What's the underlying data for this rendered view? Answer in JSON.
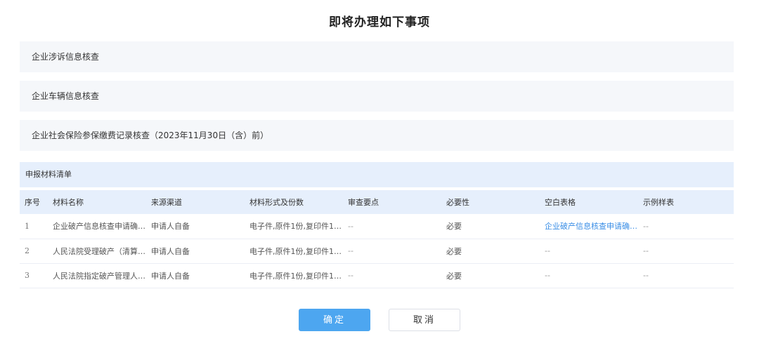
{
  "title": "即将办理如下事项",
  "matters": [
    "企业涉诉信息核查",
    "企业车辆信息核查",
    "企业社会保险参保缴费记录核查（2023年11月30日（含）前）"
  ],
  "materials": {
    "header": "申报材料清单",
    "columns": [
      "序号",
      "材料名称",
      "来源渠道",
      "材料形式及份数",
      "审查要点",
      "必要性",
      "空白表格",
      "示例样表"
    ],
    "rows": [
      {
        "index": "1",
        "name": "企业破产信息核查申请确…",
        "source": "申请人自备",
        "form": "电子件,原件1份,复印件1…",
        "review": "--",
        "necessity": "必要",
        "blank": "企业破产信息核查申请确…",
        "sample": "--"
      },
      {
        "index": "2",
        "name": "人民法院受理破产（清算…",
        "source": "申请人自备",
        "form": "电子件,原件1份,复印件1…",
        "review": "--",
        "necessity": "必要",
        "blank": "--",
        "sample": "--"
      },
      {
        "index": "3",
        "name": "人民法院指定破产管理人…",
        "source": "申请人自备",
        "form": "电子件,原件1份,复印件1…",
        "review": "--",
        "necessity": "必要",
        "blank": "--",
        "sample": "--"
      }
    ]
  },
  "buttons": {
    "confirm": "确定",
    "cancel": "取消"
  },
  "colors": {
    "primary": "#4da6f0",
    "link": "#3a8ee6",
    "header_bg": "#e6effc",
    "item_bg": "#f5f7fa"
  }
}
